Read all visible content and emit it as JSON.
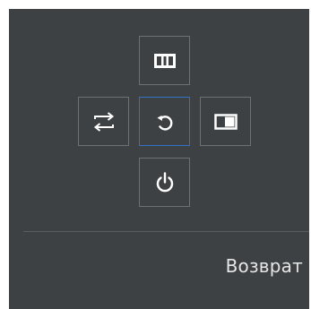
{
  "menu": {
    "selected_label": "Возврат"
  },
  "keys": {
    "up": {
      "icon": "columns-icon"
    },
    "left": {
      "icon": "swap-arrows-icon"
    },
    "center": {
      "icon": "return-arrow-icon",
      "selected": true
    },
    "right": {
      "icon": "picture-in-picture-icon"
    },
    "down": {
      "icon": "power-icon"
    }
  },
  "colors": {
    "panel_background": "#3e4144",
    "key_border": "#6d7174",
    "selected_border": "#2f74c4",
    "icon": "#ffffff",
    "label_text": "#e6e6e6"
  }
}
